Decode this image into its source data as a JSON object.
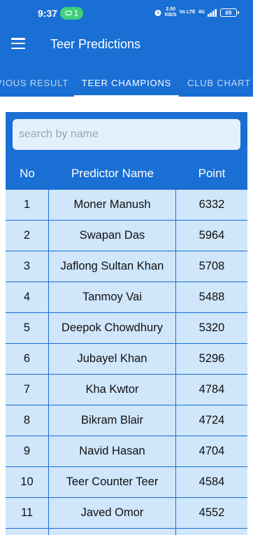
{
  "status": {
    "time": "9:37",
    "pill_count": "1",
    "speed_value": "2.00",
    "speed_unit": "KB/S",
    "network": "Vo LTE",
    "signal_label": "4G",
    "battery": "69"
  },
  "toolbar": {
    "title": "Teer Predictions"
  },
  "tabs": [
    {
      "label": "PREVIOUS RESULT"
    },
    {
      "label": "TEER CHAMPIONS",
      "active": true
    },
    {
      "label": "CLUB CHART"
    }
  ],
  "search": {
    "placeholder": "search by name",
    "value": ""
  },
  "table": {
    "headers": [
      "No",
      "Predictor Name",
      "Point"
    ],
    "rows": [
      {
        "no": "1",
        "name": "Moner Manush",
        "point": "6332"
      },
      {
        "no": "2",
        "name": "Swapan Das",
        "point": "5964"
      },
      {
        "no": "3",
        "name": "Jaflong Sultan Khan",
        "point": "5708"
      },
      {
        "no": "4",
        "name": "Tanmoy Vai",
        "point": "5488"
      },
      {
        "no": "5",
        "name": "Deepok Chowdhury",
        "point": "5320"
      },
      {
        "no": "6",
        "name": "Jubayel Khan",
        "point": "5296"
      },
      {
        "no": "7",
        "name": "Kha Kwtor",
        "point": "4784"
      },
      {
        "no": "8",
        "name": "Bikram Blair",
        "point": "4724"
      },
      {
        "no": "9",
        "name": "Navid Hasan",
        "point": "4704"
      },
      {
        "no": "10",
        "name": "Teer Counter Teer",
        "point": "4584"
      },
      {
        "no": "11",
        "name": "Javed Omor",
        "point": "4552"
      },
      {
        "no": "",
        "name": "",
        "point": ""
      }
    ]
  },
  "colors": {
    "primary": "#1a6fd4",
    "row_bg": "#cfe6fb",
    "search_bg": "#e4f1fc",
    "pill": "#3fd07a"
  }
}
